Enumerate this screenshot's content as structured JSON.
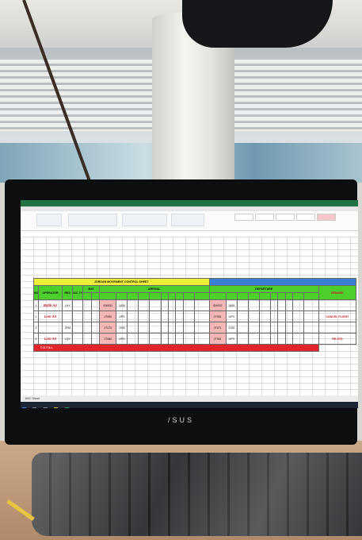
{
  "spreadsheet": {
    "title_left": "JORDAN MOVEMENT CONTROL SHEET",
    "title_right": "",
    "group_arrival": "ARRIVAL",
    "group_departure": "DEPARTURE",
    "headers": [
      "NO",
      "OPERATOR",
      "REG",
      "A/C TYPE",
      "BAY",
      "ARRIVAL",
      "DEPARTURE",
      "REMARK"
    ],
    "rows": [
      {
        "no": "1",
        "operator": "Batik Air",
        "reg": "LHY",
        "arr_flight": "ID6531",
        "arr_sta": "1630",
        "dep_flight": "ID6532",
        "dep_std": "1805",
        "remark": ""
      },
      {
        "no": "2",
        "operator": "Lion Air",
        "reg": "",
        "arr_flight": "JT950",
        "arr_sta": "UPS",
        "dep_flight": "JT951",
        "dep_std": "UPS",
        "remark": "CANCEL FLIGHT"
      },
      {
        "no": "3",
        "operator": "",
        "reg": "JRM",
        "arr_flight": "JT470",
        "arr_sta": "1930",
        "dep_flight": "JT471",
        "dep_std": "2105",
        "remark": ""
      },
      {
        "no": "4",
        "operator": "Lion Air",
        "reg": "LQY",
        "arr_flight": "JT980",
        "arr_sta": "UPS",
        "dep_flight": "JT981",
        "dep_std": "UPS",
        "remark": "RE-STD"
      }
    ],
    "total_label": "T O T A L",
    "sheet_tab": "MVC Sheet"
  },
  "monitor": {
    "brand": "/SUS"
  }
}
